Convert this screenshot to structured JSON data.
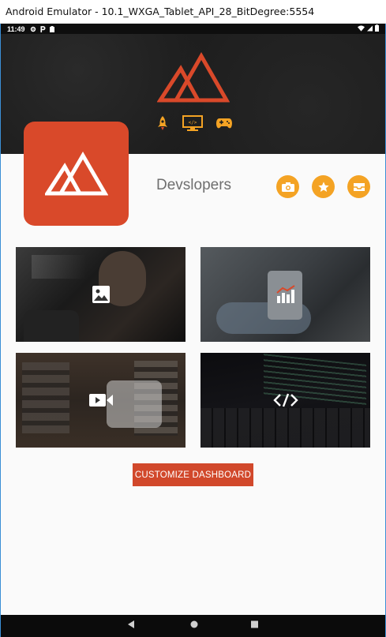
{
  "window": {
    "title": "Android Emulator - 10.1_WXGA_Tablet_API_28_BitDegree:5554"
  },
  "status_bar": {
    "time": "11:49"
  },
  "profile": {
    "name": "Devslopers"
  },
  "tiles": [
    {
      "label": "photo",
      "icon": "image-icon"
    },
    {
      "label": "analytics",
      "icon": "chart-icon"
    },
    {
      "label": "video",
      "icon": "video-camera-icon"
    },
    {
      "label": "code",
      "icon": "code-icon"
    }
  ],
  "actions": {
    "customize_label": "CUSTOMIZE DASHBOARD"
  },
  "colors": {
    "brand_orange": "#d9492a",
    "accent_yellow": "#f4a324",
    "header_dark": "#1d1d1d"
  }
}
